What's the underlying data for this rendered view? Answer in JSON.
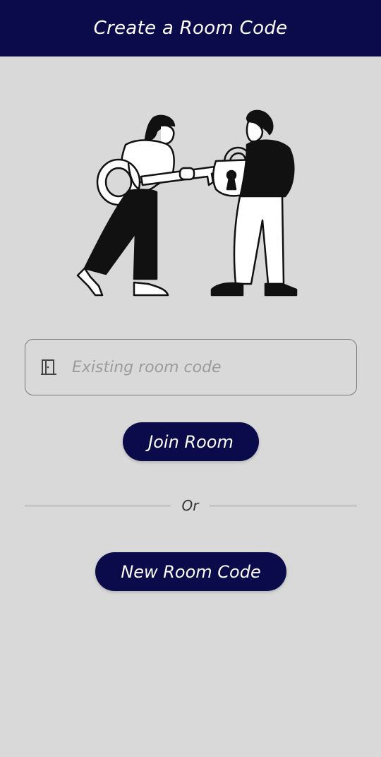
{
  "header": {
    "title": "Create a Room Code"
  },
  "room_field": {
    "icon": "door-icon",
    "placeholder": "Existing room code",
    "value": ""
  },
  "join_button": {
    "label": "Join Room"
  },
  "divider": {
    "label": "Or"
  },
  "new_code_button": {
    "label": "New Room Code"
  },
  "colors": {
    "primary": "#0b0a4a",
    "background": "#d9d9d9",
    "text_on_primary": "#ffffff"
  }
}
